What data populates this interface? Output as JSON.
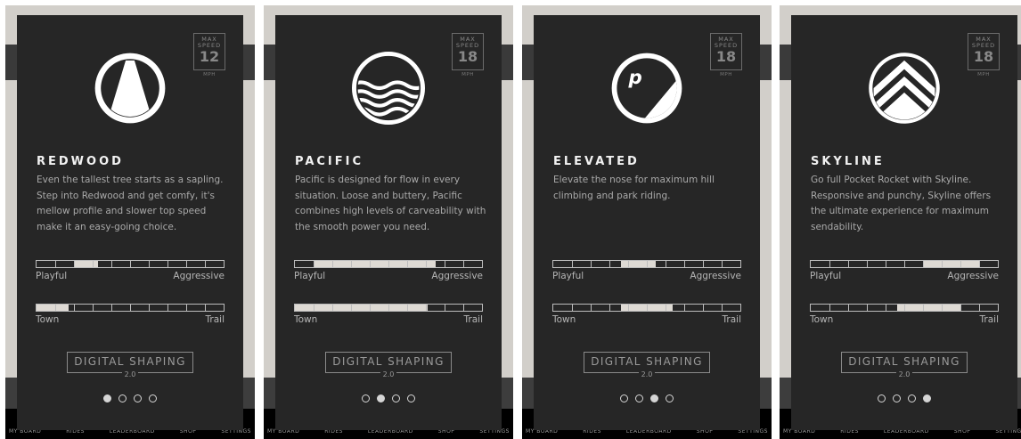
{
  "tabs": [
    "MY BOARD",
    "RIDES",
    "LEADERBOARD",
    "SHOP",
    "SETTINGS"
  ],
  "labels": {
    "max_speed": "MAX\nSPEED",
    "unit": "MPH",
    "playful": "Playful",
    "aggressive": "Aggressive",
    "town": "Town",
    "trail": "Trail",
    "digital_shaping": "DIGITAL SHAPING",
    "digital_shaping_version": "2.0"
  },
  "boards": [
    {
      "name": "REDWOOD",
      "icon": "redwood-logo-icon",
      "max_speed": "12",
      "description": "Even the tallest tree starts as a sapling. Step into Redwood and get comfy, it's mellow profile and slower top speed make it an easy-going choice.",
      "playful_aggressive": [
        0.2,
        0.33
      ],
      "town_trail": [
        0.0,
        0.17
      ],
      "active_page": 0
    },
    {
      "name": "PACIFIC",
      "icon": "pacific-waves-icon",
      "max_speed": "18",
      "description": "Pacific is designed for flow in every situation. Loose and buttery, Pacific combines high levels of carveability with the smooth power you need.",
      "playful_aggressive": [
        0.1,
        0.75
      ],
      "town_trail": [
        0.0,
        0.71
      ],
      "active_page": 1
    },
    {
      "name": "ELEVATED",
      "icon": "elevated-p-icon",
      "max_speed": "18",
      "description": "Elevate the nose for maximum hill climbing and park riding.",
      "playful_aggressive": [
        0.36,
        0.55
      ],
      "town_trail": [
        0.36,
        0.64
      ],
      "active_page": 2
    },
    {
      "name": "SKYLINE",
      "icon": "skyline-chevron-icon",
      "max_speed": "18",
      "description": "Go full Pocket Rocket with Skyline. Responsive and punchy, Skyline offers the ultimate experience for maximum sendability.",
      "playful_aggressive": [
        0.6,
        0.9
      ],
      "town_trail": [
        0.46,
        0.8
      ],
      "active_page": 3
    }
  ]
}
